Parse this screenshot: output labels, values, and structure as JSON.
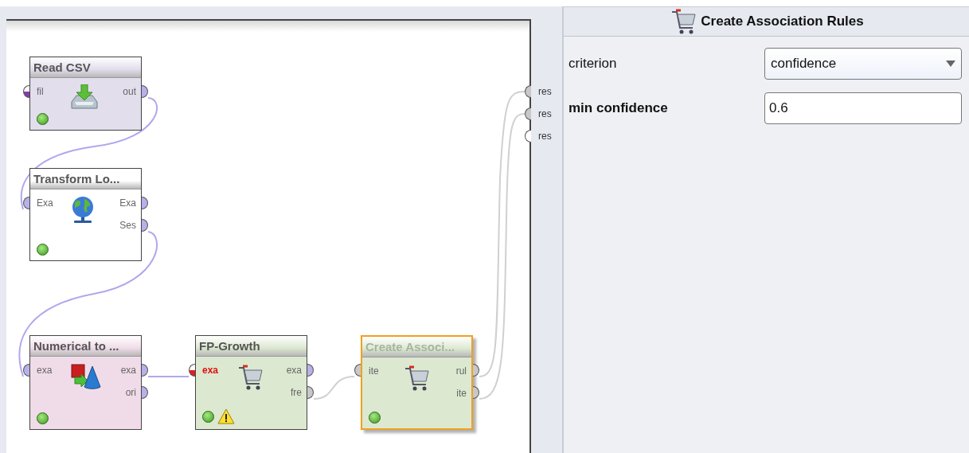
{
  "nodes": [
    {
      "title": "Read CSV",
      "color": "#e2deec",
      "selected": false,
      "warning": false,
      "kind": "import",
      "inputs": [
        {
          "label": "fil",
          "color": "#8a3aa8",
          "kind": "half",
          "error": false
        }
      ],
      "outputs": [
        {
          "label": "out",
          "color": "#b8b0ea",
          "kind": "full"
        }
      ]
    },
    {
      "title": "Transform Lo...",
      "color": "#ffffff",
      "selected": false,
      "warning": false,
      "kind": "globe",
      "inputs": [
        {
          "label": "Exa",
          "color": "#b8b0ea",
          "kind": "full",
          "error": false
        }
      ],
      "outputs": [
        {
          "label": "Exa",
          "color": "#b8b0ea",
          "kind": "full"
        },
        {
          "label": "Ses",
          "color": "#b8b0ea",
          "kind": "full"
        }
      ]
    },
    {
      "title": "Numerical to ...",
      "color": "#f0dce8",
      "selected": false,
      "warning": false,
      "kind": "convert",
      "inputs": [
        {
          "label": "exa",
          "color": "#b8b0ea",
          "kind": "full",
          "error": false
        }
      ],
      "outputs": [
        {
          "label": "exa",
          "color": "#b8b0ea",
          "kind": "full"
        },
        {
          "label": "ori",
          "color": "#b8b0ea",
          "kind": "full"
        }
      ]
    },
    {
      "title": "FP-Growth",
      "color": "#dce8d0",
      "selected": false,
      "warning": true,
      "kind": "cart",
      "inputs": [
        {
          "label": "exa",
          "color": "#e02020",
          "kind": "half",
          "error": true
        }
      ],
      "outputs": [
        {
          "label": "exa",
          "color": "#b8b0ea",
          "kind": "full"
        },
        {
          "label": "fre",
          "color": "#c8c8c8",
          "kind": "full"
        }
      ]
    },
    {
      "title": "Create Associ...",
      "color": "#dce8d0",
      "selected": true,
      "warning": false,
      "kind": "cart",
      "inputs": [
        {
          "label": "ite",
          "color": "#c8c8c8",
          "kind": "full",
          "error": false
        }
      ],
      "outputs": [
        {
          "label": "rul",
          "color": "#c8c8c8",
          "kind": "full"
        },
        {
          "label": "ite",
          "color": "#c8c8c8",
          "kind": "full"
        }
      ]
    }
  ],
  "results": [
    {
      "label": "res",
      "color": "#c8c8c8"
    },
    {
      "label": "res",
      "color": "#c8c8c8"
    },
    {
      "label": "res",
      "color": "#ffffff"
    }
  ],
  "panel": {
    "title": "Create Association Rules",
    "parameters": [
      {
        "kind": "select",
        "label": "criterion",
        "value": "confidence",
        "required": false
      },
      {
        "kind": "text",
        "label": "min confidence",
        "value": "0.6",
        "required": true
      }
    ]
  }
}
